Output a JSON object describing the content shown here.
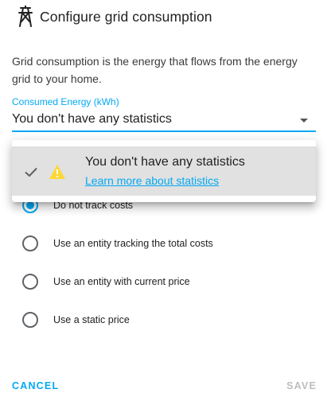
{
  "dialog": {
    "title": "Configure grid consumption",
    "icon": "transmission-tower-icon",
    "description": "Grid consumption is the energy that flows from the energy grid to your home."
  },
  "statistic_select": {
    "label": "Consumed Energy (kWh)",
    "value": "You don't have any statistics",
    "accent_color": "#03a9f4"
  },
  "dropdown": {
    "item_primary": "You don't have any statistics",
    "item_link": "Learn more about statistics",
    "warning_color": "#fdd835"
  },
  "cost_options": [
    {
      "label": "Do not track costs",
      "checked": true
    },
    {
      "label": "Use an entity tracking the total costs",
      "checked": false
    },
    {
      "label": "Use an entity with current price",
      "checked": false
    },
    {
      "label": "Use a static price",
      "checked": false
    }
  ],
  "actions": {
    "cancel_label": "CANCEL",
    "save_label": "SAVE"
  }
}
